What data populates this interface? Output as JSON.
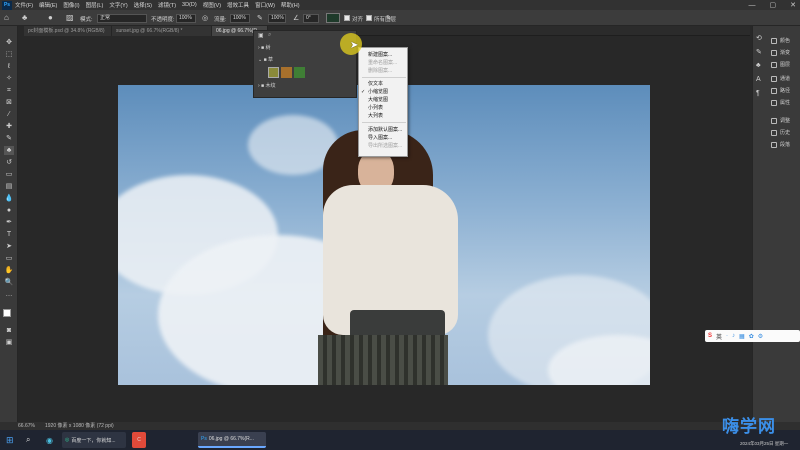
{
  "app": {
    "logo": "Ps"
  },
  "menu": [
    "文件(F)",
    "编辑(E)",
    "图像(I)",
    "图层(L)",
    "文字(Y)",
    "选择(S)",
    "滤镜(T)",
    "3D(D)",
    "视图(V)",
    "增效工具",
    "窗口(W)",
    "帮助(H)"
  ],
  "window_controls": [
    "—",
    "▢",
    "✕"
  ],
  "options": {
    "mode_label": "模式:",
    "mode_value": "正常",
    "opacity_label": "不透明度:",
    "opacity_value": "100%",
    "flow_label": "流量:",
    "flow_value": "100%",
    "smoothing_value": "100%",
    "angle_value": "0°",
    "align_label": "对齐",
    "sample_label": "所有图层",
    "sample_value": "当前图层"
  },
  "tabs": [
    {
      "label": "pc封面模板.psd @ 34.8% (RGB/8)",
      "active": false
    },
    {
      "label": "sunset.jpg @ 66.7%(RGB/8) *",
      "active": false
    },
    {
      "label": "06.jpg @ 66.7%(R",
      "active": true
    }
  ],
  "panel_popup": {
    "rows": [
      "树",
      "草",
      "",
      "木纹"
    ]
  },
  "context_menu": {
    "items": [
      {
        "label": "新建图案...",
        "disabled": false
      },
      {
        "label": "重命名图案...",
        "disabled": true
      },
      {
        "label": "删除图案...",
        "disabled": true
      },
      {
        "sep": true
      },
      {
        "label": "仅文本",
        "disabled": false
      },
      {
        "label": "小缩览图",
        "disabled": false,
        "checked": true
      },
      {
        "label": "大缩览图",
        "disabled": false
      },
      {
        "label": "小列表",
        "disabled": false
      },
      {
        "label": "大列表",
        "disabled": false
      },
      {
        "sep": true
      },
      {
        "label": "添加默认图案...",
        "disabled": false
      },
      {
        "label": "导入图案...",
        "disabled": false
      },
      {
        "label": "导出所选图案...",
        "disabled": true
      }
    ]
  },
  "right_panel": [
    "颜色",
    "渐变",
    "图层",
    "通道",
    "路径",
    "属性",
    "调整",
    "历史",
    "段落",
    "字符"
  ],
  "status": {
    "zoom": "66.67%",
    "doc": "1920 像素 x 1080 像素 (72 ppi)"
  },
  "taskbar": {
    "search_hint": "百度一下，你就知...",
    "ps_label": "06.jpg @ 66.7%(R...",
    "date": "2024年03月25日 星期一"
  },
  "ime": {
    "label": "英"
  },
  "watermark": "嗨学网"
}
